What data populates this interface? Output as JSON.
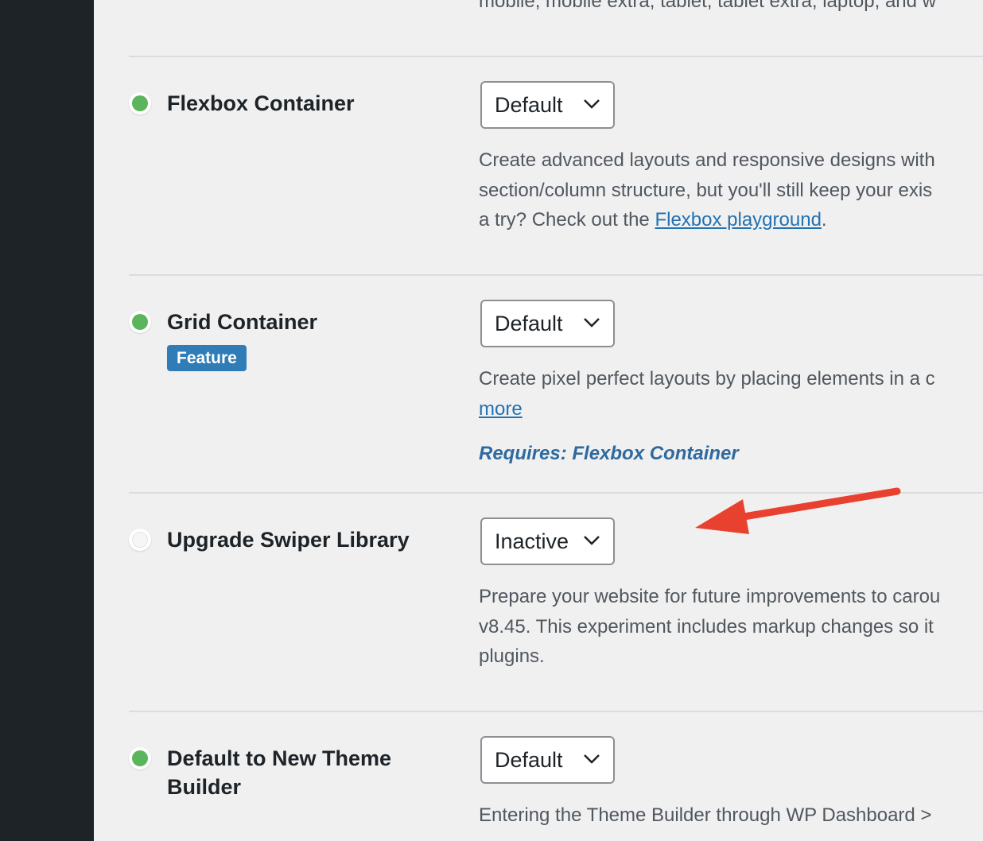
{
  "top_fragment": "mobile, mobile extra, tablet, tablet extra, laptop, and w",
  "experiments": [
    {
      "name": "Flexbox Container",
      "status": "active",
      "select_value": "Default",
      "description_lines": [
        "Create advanced layouts and responsive designs with",
        "section/column structure, but you'll still keep your exis"
      ],
      "description_tail_prefix": "a try? Check out the ",
      "link_label": "Flexbox playground",
      "description_tail_suffix": "."
    },
    {
      "name": "Grid Container",
      "badge": "Feature",
      "status": "active",
      "select_value": "Default",
      "description_lines": [
        "Create pixel perfect layouts by placing elements in a c"
      ],
      "link_label": "more",
      "requires": "Requires: Flexbox Container"
    },
    {
      "name": "Upgrade Swiper Library",
      "status": "inactive",
      "select_value": "Inactive",
      "description_lines": [
        "Prepare your website for future improvements to carou",
        "v8.45. This experiment includes markup changes so it",
        "plugins."
      ]
    },
    {
      "name_line1": "Default to New Theme",
      "name_line2": "Builder",
      "status": "active",
      "select_value": "Default",
      "description_lines": [
        "Entering the Theme Builder through WP Dashboard >",
        "                                                                  "
      ]
    }
  ],
  "colors": {
    "active": "#5bb65b",
    "annotation_arrow": "#e8412f",
    "link": "#2271b1",
    "badge": "#2f7cb6"
  }
}
